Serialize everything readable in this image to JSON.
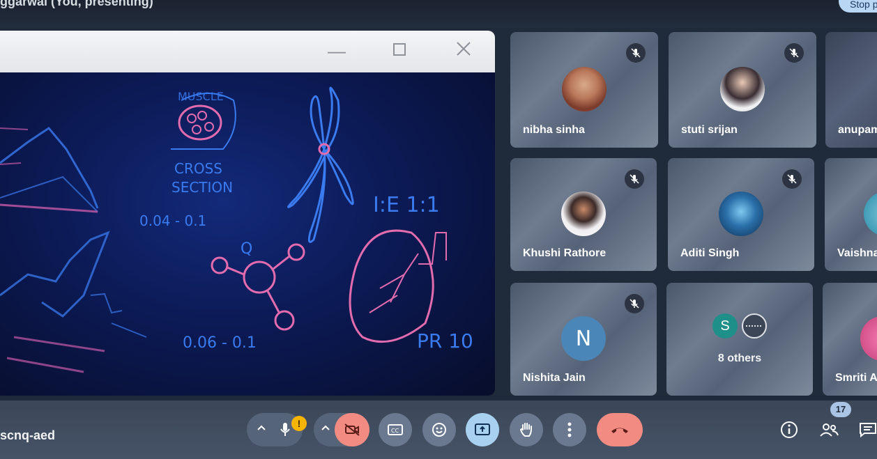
{
  "header": {
    "presenting_label": "ggarwal (You, presenting)",
    "stop_button_label": "Stop presenting"
  },
  "presentation": {
    "window_controls": [
      "minimize-icon",
      "maximize-icon",
      "close-icon"
    ],
    "board_notes": {
      "muscle": "MUSCLE",
      "cross_section_1": "CROSS",
      "cross_section_2": "SECTION",
      "range_1": "0.04 - 0.1",
      "range_2": "0.06 - 0.1",
      "q_label": "Q",
      "ie_ratio": "I:E 1:1",
      "pr": "PR 10"
    }
  },
  "participants": [
    {
      "name": "nibha sinha",
      "muted": true,
      "avatar": "photo"
    },
    {
      "name": "stuti srijan",
      "muted": true,
      "avatar": "photo"
    },
    {
      "name": "anupam",
      "muted": false,
      "avatar": "none"
    },
    {
      "name": "Khushi Rathore",
      "muted": true,
      "avatar": "photo"
    },
    {
      "name": "Aditi Singh",
      "muted": true,
      "avatar": "photo"
    },
    {
      "name": "Vaishnavi",
      "muted": false,
      "avatar": "photo"
    },
    {
      "name": "Nishita Jain",
      "muted": true,
      "avatar": "letter",
      "letter": "N"
    },
    {
      "name": "8 others",
      "muted": false,
      "avatar": "group",
      "letter": "S"
    },
    {
      "name": "Smriti A",
      "muted": false,
      "avatar": "photo"
    }
  ],
  "bottombar": {
    "meeting_code": "scnq-aed",
    "mic_warning": "!",
    "people_count": "17",
    "icons": [
      "chevron-up-icon",
      "microphone-icon",
      "chevron-up-icon",
      "camera-off-icon",
      "captions-icon",
      "emoji-icon",
      "present-icon",
      "raise-hand-icon",
      "more-options-icon",
      "end-call-icon",
      "info-icon",
      "people-icon",
      "chat-icon"
    ]
  },
  "colors": {
    "accent_blue": "#b9d7f5",
    "end_call_red": "#f28b82",
    "camera_off_red": "#f28b82",
    "present_active": "#a8d1f0",
    "warning_yellow": "#f5b400"
  }
}
